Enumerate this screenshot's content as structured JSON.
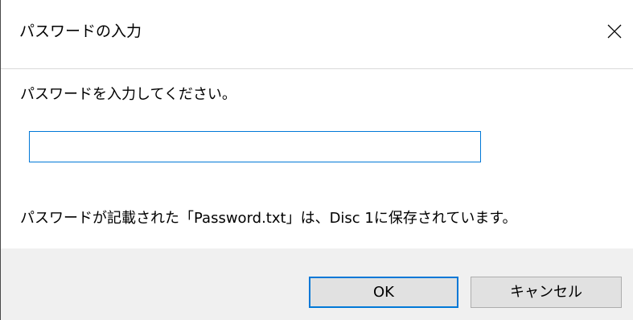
{
  "dialog": {
    "title": "パスワードの入力",
    "close_icon": "close-icon",
    "prompt": "パスワードを入力してください。",
    "password": {
      "value": "",
      "placeholder": ""
    },
    "note": "パスワードが記載された「Password.txt」は、Disc 1に保存されています。",
    "buttons": {
      "ok_label": "OK",
      "cancel_label": "キャンセル"
    }
  },
  "colors": {
    "accent": "#0078d7",
    "footer_bg": "#f0f0f0",
    "button_bg": "#e1e1e1"
  }
}
